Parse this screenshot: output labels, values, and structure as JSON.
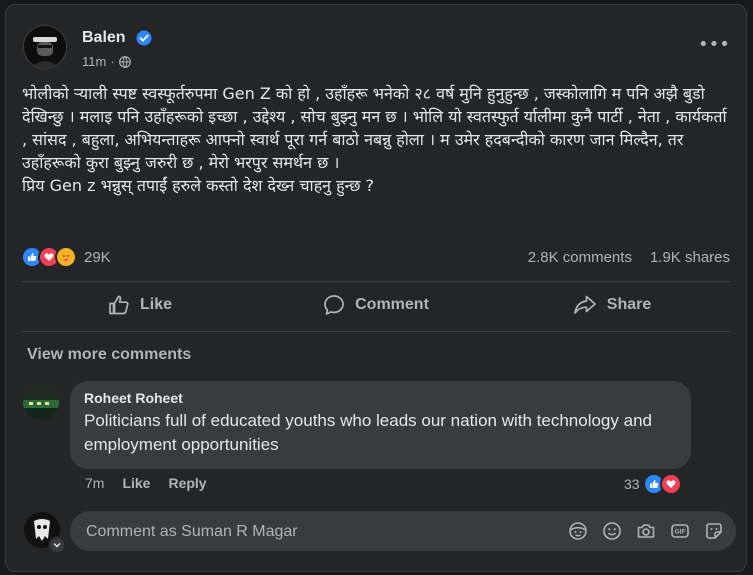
{
  "post": {
    "author": "Balen",
    "time": "11m",
    "lines": [
      "भोलीको र्‍याली स्पष्ट स्वस्फूर्तरुपमा Gen Z को हो , उहाँहरू भनेको २८ वर्ष मुनि हुनुहुन्छ , जस्कोलागि म पनि अझै बुडो देखिन्छु । मलाइ पनि उहाँहरूको इच्छा , उद्देश्य , सोच बुझ्नु मन छ । भोलि यो स्वतस्फुर्त र्यालीमा कुनै पार्टी , नेता , कार्यकर्ता , सांसद , बहुला, अभियन्ताहरू आफ्नो स्वार्थ पूरा गर्न बाठो नबन्नु होला । म उमेर हदबन्दीको कारण जान मिल्दैन, तर उहाँहरूको कुरा बुझ्नु जरुरी छ , मेरो भरपुर समर्थन छ ।",
      "प्रिय Gen z भन्नुस् तपाईं हरुले कस्तो देश देख्न चाहनु हुन्छ ?"
    ],
    "reaction_count": "29K",
    "comments_count": "2.8K comments",
    "shares_count": "1.9K shares"
  },
  "actions": {
    "like": "Like",
    "comment": "Comment",
    "share": "Share"
  },
  "view_more": "View more comments",
  "comment": {
    "author": "Roheet Roheet",
    "text": "Politicians full of educated youths who leads our nation with technology and employment opportunities",
    "time": "7m",
    "like": "Like",
    "reply": "Reply",
    "reaction_count": "33"
  },
  "composer": {
    "placeholder": "Comment as Suman R Magar"
  },
  "colors": {
    "like_blue": "#2d88ff",
    "love_red": "#f33e58",
    "care_yellow": "#f7b125"
  }
}
